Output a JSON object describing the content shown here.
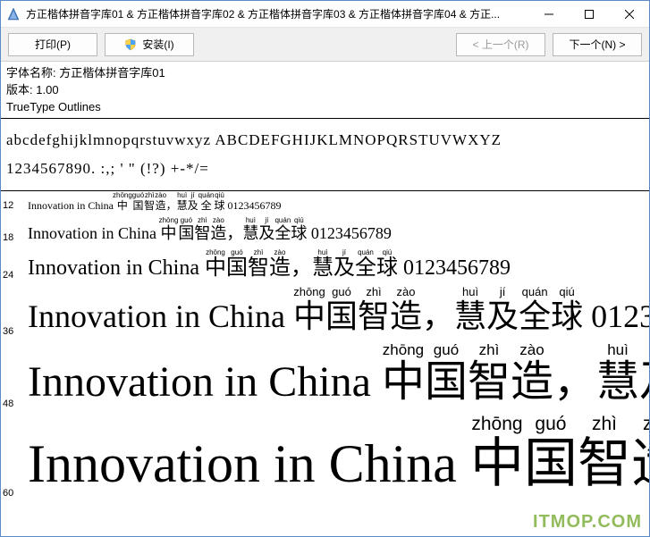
{
  "window": {
    "title": "方正楷体拼音字库01  & 方正楷体拼音字库02  & 方正楷体拼音字库03  & 方正楷体拼音字库04  & 方正..."
  },
  "toolbar": {
    "print_label": "打印(P)",
    "install_label": "安装(I)",
    "prev_label": "< 上一个(R)",
    "next_label": "下一个(N) >"
  },
  "info": {
    "name_label": "字体名称:",
    "name_value": "方正楷体拼音字库01",
    "version_label": "版本:",
    "version_value": "1.00",
    "outlines": "TrueType Outlines"
  },
  "charset": {
    "line1": "abcdefghijklmnopqrstuvwxyz ABCDEFGHIJKLMNOPQRSTUVWXYZ",
    "line2": "1234567890. :,; ' \" (!?) +-*/="
  },
  "sample": {
    "english": "Innovation in China ",
    "digits": " 0123456789",
    "comma": "，",
    "cjk": [
      {
        "char": "中",
        "py": "zhōng"
      },
      {
        "char": "国",
        "py": "guó"
      },
      {
        "char": "智",
        "py": "zhì"
      },
      {
        "char": "造",
        "py": "zào"
      }
    ],
    "cjk2": [
      {
        "char": "慧",
        "py": "huì"
      },
      {
        "char": "及",
        "py": "jí"
      },
      {
        "char": "全",
        "py": "quán"
      },
      {
        "char": "球",
        "py": "qiú"
      }
    ],
    "sizes": [
      12,
      18,
      24,
      36,
      48,
      60
    ]
  },
  "watermark": "ITMOP.COM"
}
